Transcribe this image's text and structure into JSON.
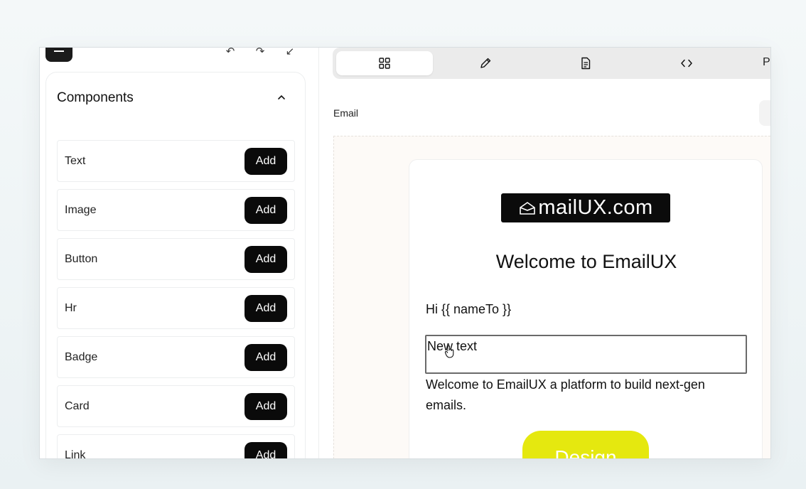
{
  "sidebar": {
    "title": "Components",
    "items": [
      {
        "label": "Text",
        "button": "Add"
      },
      {
        "label": "Image",
        "button": "Add"
      },
      {
        "label": "Button",
        "button": "Add"
      },
      {
        "label": "Hr",
        "button": "Add"
      },
      {
        "label": "Badge",
        "button": "Add"
      },
      {
        "label": "Card",
        "button": "Add"
      },
      {
        "label": "Link",
        "button": "Add"
      }
    ]
  },
  "toolbar": {
    "tabs": [
      {
        "icon": "grid-icon",
        "active": true
      },
      {
        "icon": "pencil-icon",
        "active": false
      },
      {
        "icon": "document-icon",
        "active": false
      },
      {
        "icon": "code-icon",
        "active": false
      }
    ],
    "extra_label": "P"
  },
  "editor": {
    "section_label": "Email"
  },
  "email": {
    "logo_text": "mailUX.com",
    "title": "Welcome to EmailUX",
    "greeting": "Hi {{ nameTo }}",
    "new_text": "New text",
    "body": "Welcome to EmailUX a platform to build next-gen emails.",
    "cta": "Design"
  },
  "colors": {
    "accent": "#e5e80f",
    "button_dark": "#0a0a0a"
  }
}
